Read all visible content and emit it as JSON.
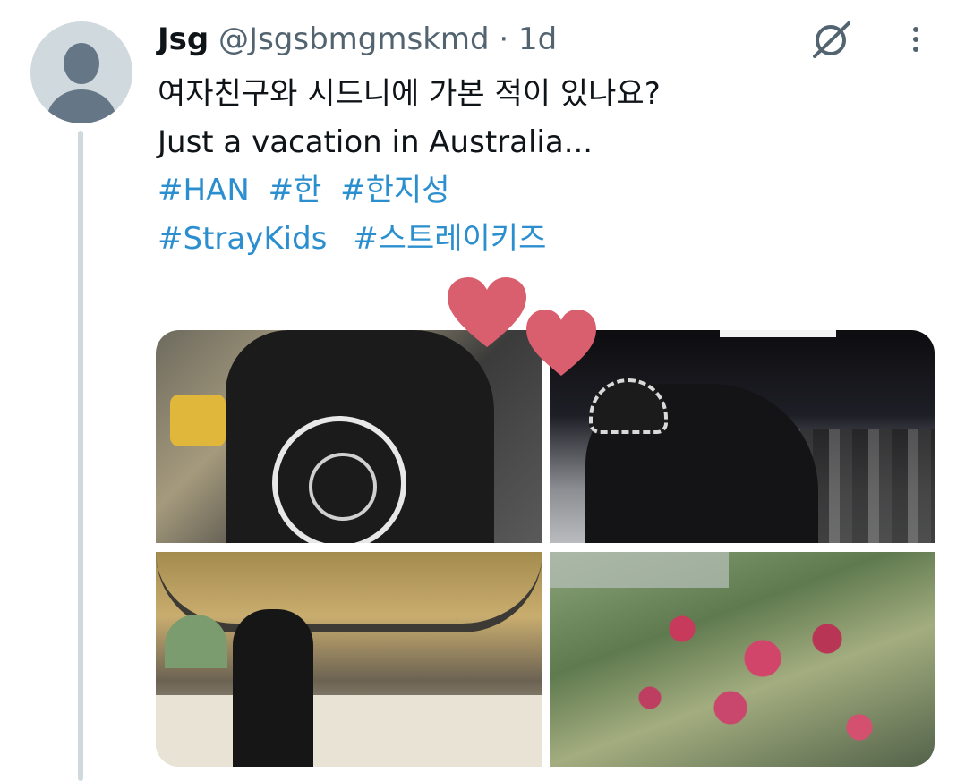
{
  "tweet": {
    "display_name": "Jsg",
    "handle": "@Jsgsbmgmskmd",
    "separator": "·",
    "time": "1d",
    "text_lines": [
      "여자친구와 시드니에 가본 적이 있나요?",
      "Just a vacation in Australia..."
    ],
    "hashtags_row1": [
      "#HAN",
      "#한",
      "#한지성"
    ],
    "hashtags_row2": [
      "#StrayKids",
      "#스트레이키즈"
    ]
  },
  "icons": {
    "avatar": "default-avatar-icon",
    "grok": "grok-icon",
    "more": "more-vertical-icon",
    "stickers": "heart-sticker-icon"
  },
  "colors": {
    "hashtag": "#2b8fcf",
    "name": "#0f1419",
    "secondary": "#536471",
    "thread_line": "#cfd9de",
    "heart": "#d95f6e"
  }
}
